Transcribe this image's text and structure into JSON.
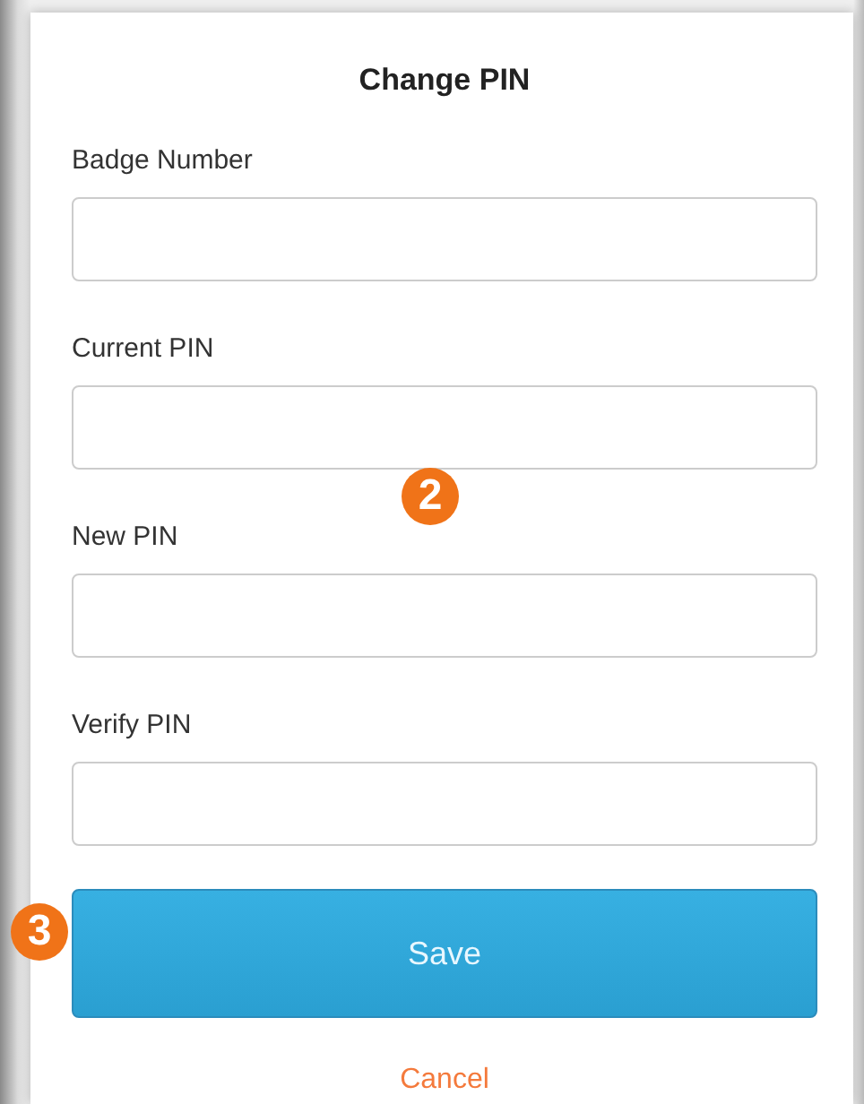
{
  "dialog": {
    "title": "Change PIN"
  },
  "fields": [
    {
      "label": "Badge Number"
    },
    {
      "label": "Current PIN"
    },
    {
      "label": "New PIN"
    },
    {
      "label": "Verify PIN"
    }
  ],
  "save_button": "Save",
  "cancel_link": "Cancel",
  "callouts": [
    {
      "number": "2"
    },
    {
      "number": "3"
    }
  ]
}
